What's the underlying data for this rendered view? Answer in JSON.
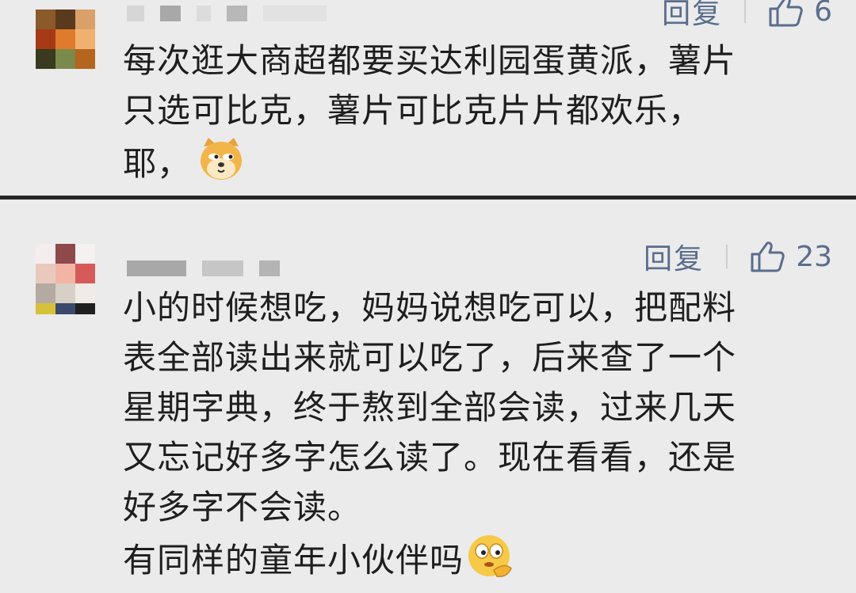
{
  "comments": [
    {
      "actions": {
        "reply_label": "回复",
        "like_count": "6"
      },
      "lines": [
        "每次逛大商超都要买达利园蛋黄派，薯片",
        "只选可比克，薯片可比克片片都欢乐，",
        "耶，"
      ],
      "trailing_emoji": "doge-emoji"
    },
    {
      "actions": {
        "reply_label": "回复",
        "like_count": "23"
      },
      "lines": [
        "小的时候想吃，妈妈说想吃可以，把配料",
        "表全部读出来就可以吃了，后来查了一个",
        "星期字典，终于熬到全部会读，过来几天",
        "又忘记好多字怎么读了。现在看看，还是",
        "好多字不会读。",
        "有同样的童年小伙伴吗"
      ],
      "trailing_emoji": "thinking-face-emoji"
    }
  ],
  "colors": {
    "background": "#ebebeb",
    "divider": "#262626",
    "action_text": "#5a6d8c",
    "body_text": "#1e1e1e"
  }
}
